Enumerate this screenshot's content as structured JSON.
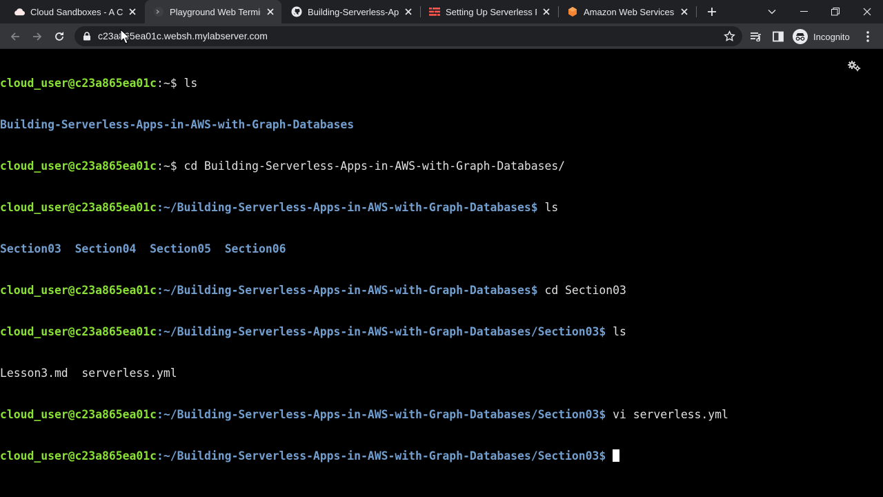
{
  "tabs": [
    {
      "title": "Cloud Sandboxes - A Cloud Guru",
      "icon": "cloud-icon",
      "active": false
    },
    {
      "title": "Playground Web Terminal",
      "icon": "terminal-icon",
      "active": true
    },
    {
      "title": "Building-Serverless-Apps-in-AWS",
      "icon": "github-icon",
      "active": false
    },
    {
      "title": "Setting Up Serverless Framework",
      "icon": "serverless-icon",
      "active": false
    },
    {
      "title": "Amazon Web Services Sign-In",
      "icon": "aws-icon",
      "active": false
    }
  ],
  "address_bar": {
    "url": "c23a865ea01c.websh.mylabserver.com"
  },
  "profile": {
    "label": "Incognito"
  },
  "terminal": {
    "user_host": "cloud_user@c23a865ea01c",
    "home_prompt_suffix": ":~$",
    "repo_path": ":~/Building-Serverless-Apps-in-AWS-with-Graph-Databases$",
    "section_path": ":~/Building-Serverless-Apps-in-AWS-with-Graph-Databases/Section03$",
    "cmd_ls": " ls",
    "cmd_cd_repo": " cd Building-Serverless-Apps-in-AWS-with-Graph-Databases/",
    "cmd_cd_section": " cd Section03",
    "cmd_vi": " vi serverless.yml",
    "ls_home_output": "Building-Serverless-Apps-in-AWS-with-Graph-Databases",
    "ls_repo_output": [
      "Section03",
      "Section04",
      "Section05",
      "Section06"
    ],
    "ls_section_output": "Lesson3.md  serverless.yml"
  },
  "colors": {
    "prompt_user": "#8ae234",
    "prompt_path": "#729fcf",
    "terminal_bg": "#000000",
    "chrome_tabstrip": "#202124",
    "chrome_toolbar": "#35363a"
  }
}
